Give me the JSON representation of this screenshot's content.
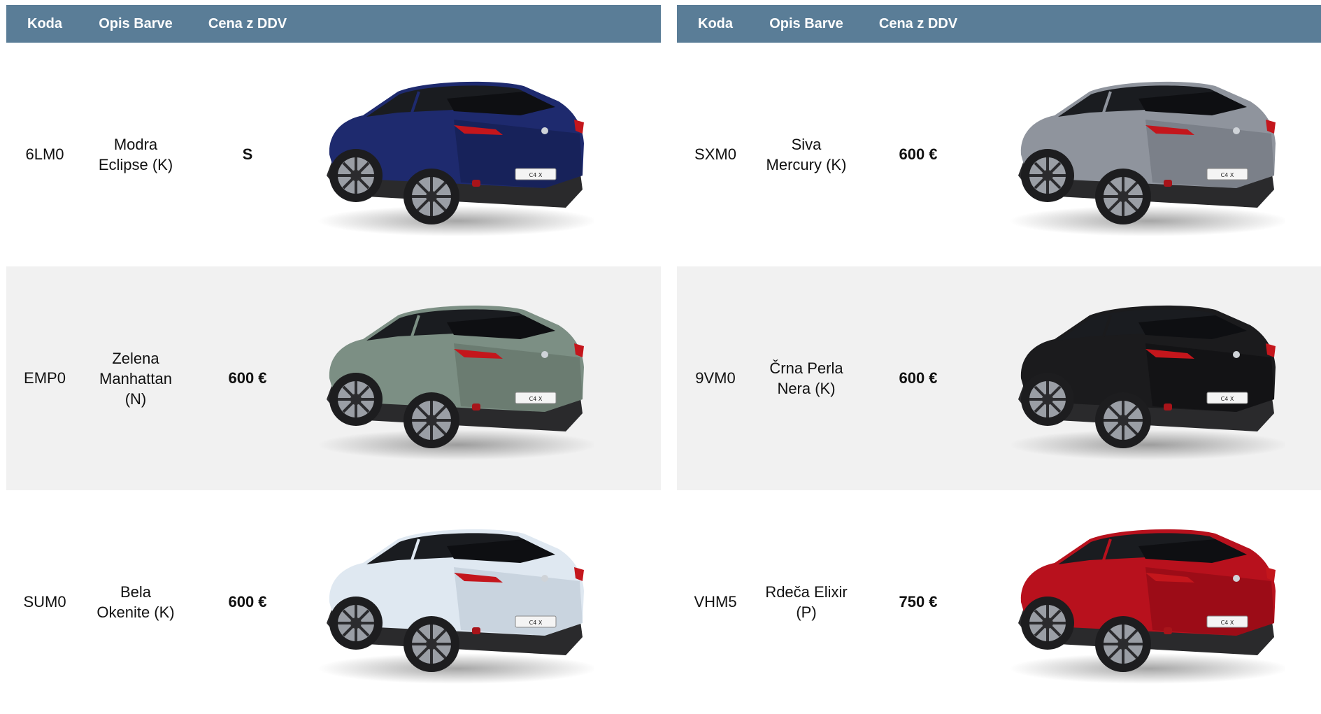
{
  "headers": {
    "code": "Koda",
    "description": "Opis Barve",
    "price": "Cena z DDV"
  },
  "left_rows": [
    {
      "code": "6LM0",
      "desc_line1": "Modra",
      "desc_line2": "Eclipse (K)",
      "desc_line3": "",
      "price": "S",
      "body_color": "#1e2a6e",
      "body_shade": "#131b4a",
      "background": "#ffffff"
    },
    {
      "code": "EMP0",
      "desc_line1": "Zelena",
      "desc_line2": "Manhattan",
      "desc_line3": "(N)",
      "price": "600 €",
      "body_color": "#7c8f84",
      "body_shade": "#5c6d63",
      "background": "#f1f1f1"
    },
    {
      "code": "SUM0",
      "desc_line1": "Bela",
      "desc_line2": "Okenite (K)",
      "desc_line3": "",
      "price": "600 €",
      "body_color": "#dfe8f1",
      "body_shade": "#b7c3cf",
      "background": "#ffffff"
    }
  ],
  "right_rows": [
    {
      "code": "SXM0",
      "desc_line1": "Siva",
      "desc_line2": "Mercury (K)",
      "desc_line3": "",
      "price": "600 €",
      "body_color": "#8f949d",
      "body_shade": "#6b7079",
      "background": "#ffffff"
    },
    {
      "code": "9VM0",
      "desc_line1": "Črna Perla",
      "desc_line2": "Nera (K)",
      "desc_line3": "",
      "price": "600 €",
      "body_color": "#1b1b1d",
      "body_shade": "#0d0d0e",
      "background": "#f1f1f1"
    },
    {
      "code": "VHM5",
      "desc_line1": "Rdeča Elixir",
      "desc_line2": "(P)",
      "desc_line3": "",
      "price": "750 €",
      "body_color": "#b8111d",
      "body_shade": "#850a13",
      "background": "#ffffff"
    }
  ],
  "header_color": "#5a7d97",
  "plate_text": "C4 X"
}
